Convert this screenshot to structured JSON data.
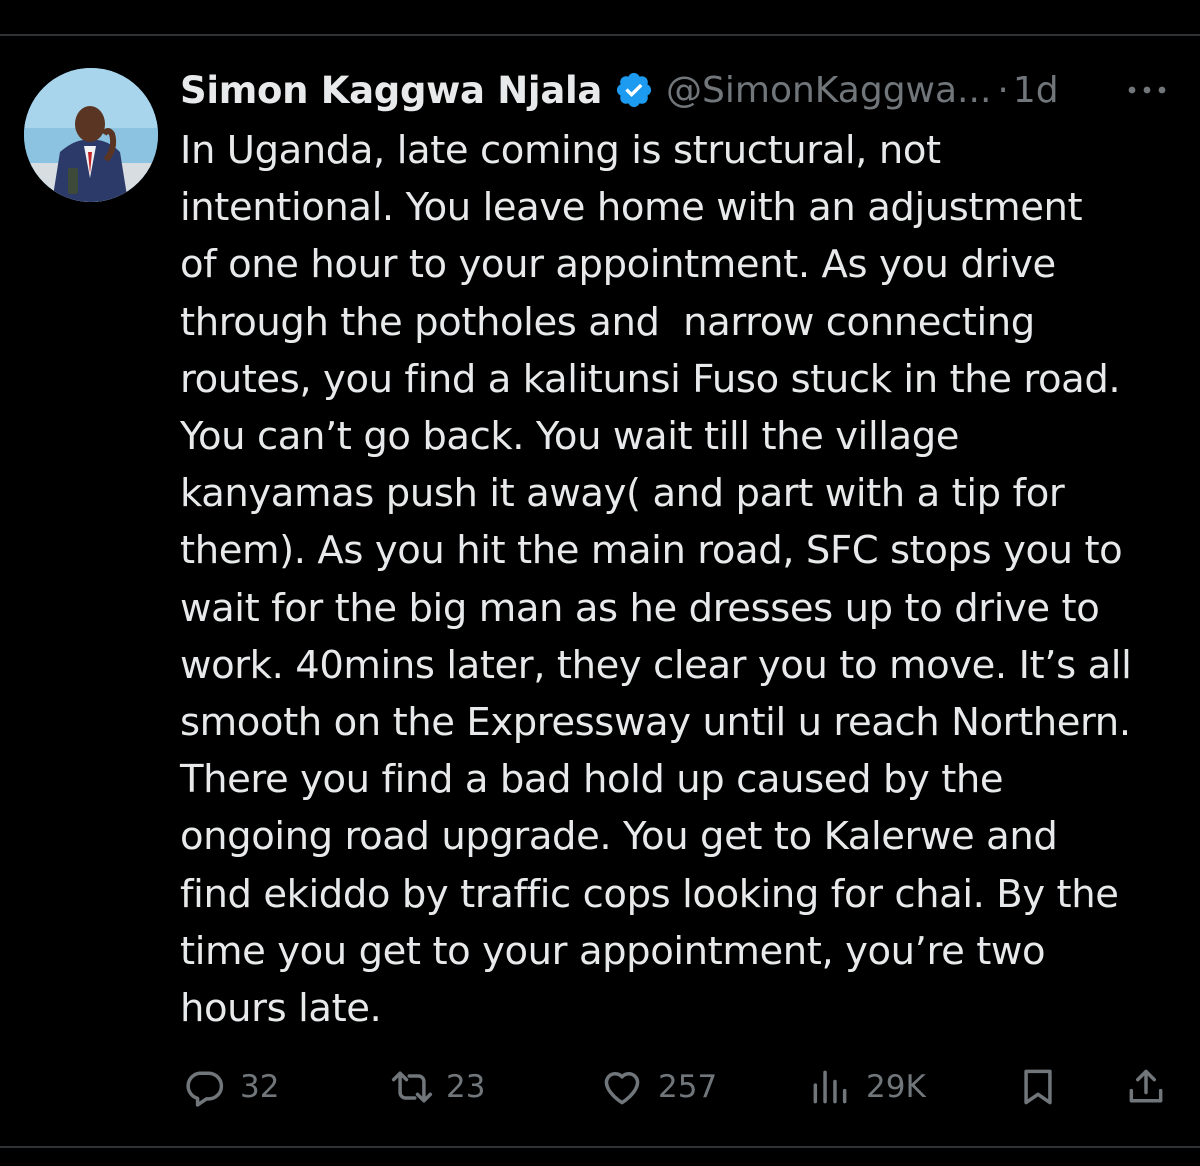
{
  "tweet": {
    "author_name": "Simon Kaggwa Njala",
    "handle": "@SimonKaggwa...",
    "separator": "·",
    "time": "1d",
    "text": "In Uganda, late coming is structural, not\nintentional. You leave home with an adjustment\nof one hour to your appointment. As you drive\nthrough the potholes and  narrow connecting\nroutes, you find a kalitunsi Fuso stuck in the road.\nYou can’t go back. You wait till the village\nkanyamas push it away( and part with a tip for\nthem). As you hit the main road, SFC stops you to\nwait for the big man as he dresses up to drive to\nwork. 40mins later, they clear you to move. It’s all\nsmooth on the Expressway until u reach Northern.\nThere you find a bad hold up caused by the\nongoing road upgrade. You get to Kalerwe and\nfind ekiddo by traffic cops looking for chai. By the\ntime you get to your appointment, you’re two\nhours late."
  },
  "actions": {
    "replies": "32",
    "reposts": "23",
    "likes": "257",
    "views": "29K"
  },
  "icons": {
    "verified": "verified-badge-icon",
    "more": "more-dots-icon",
    "reply": "reply-icon",
    "repost": "repost-icon",
    "like": "heart-icon",
    "views": "views-icon",
    "bookmark": "bookmark-icon",
    "share": "share-icon"
  },
  "colors": {
    "background": "#000000",
    "text": "#e7e9ea",
    "secondary": "#71767b",
    "verified": "#1d9bf0",
    "divider": "#2f3336"
  }
}
